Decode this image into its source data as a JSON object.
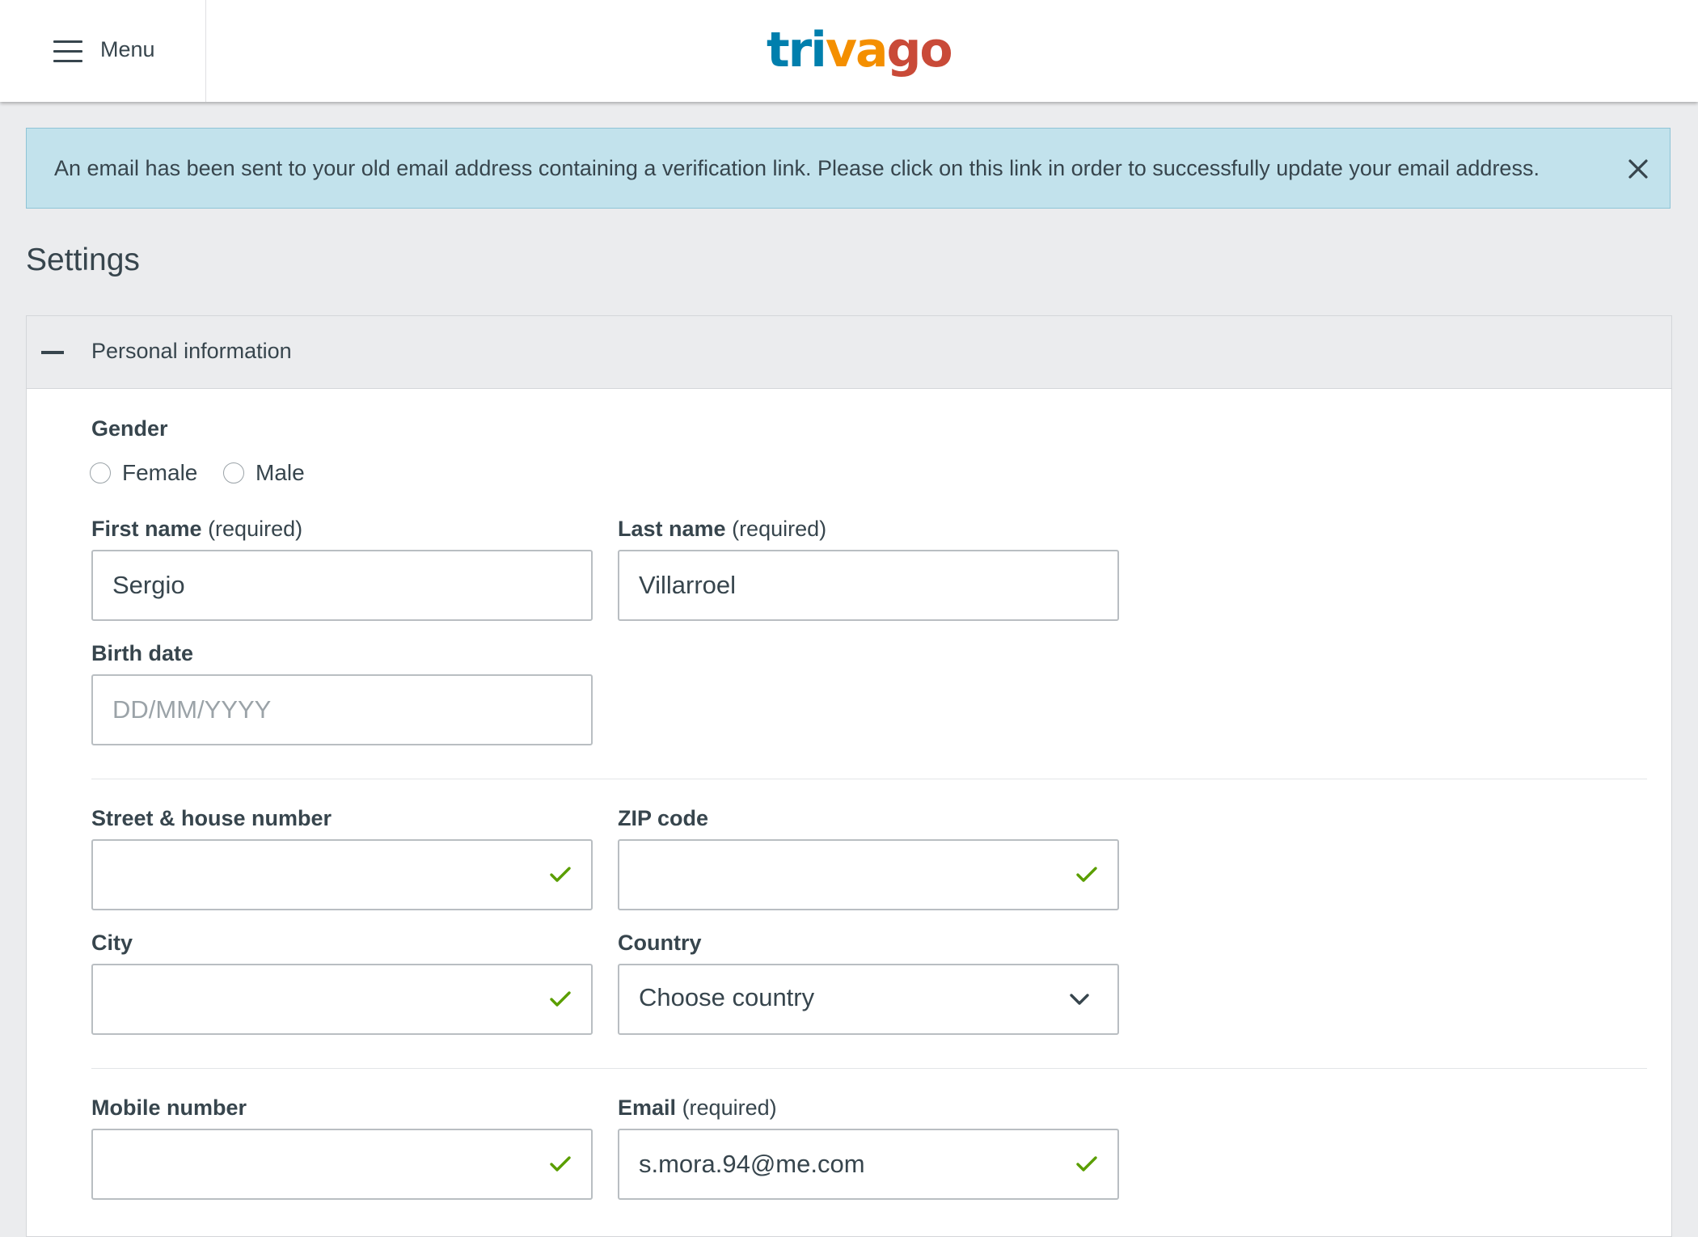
{
  "header": {
    "menu_label": "Menu",
    "logo": {
      "part1": "tri",
      "part2": "va",
      "part3": "go"
    }
  },
  "alert": {
    "message": "An email has been sent to your old email address containing a verification link. Please click on this link in order to successfully update your email address."
  },
  "page_title": "Settings",
  "section": {
    "title": "Personal information",
    "gender": {
      "label": "Gender",
      "options": [
        "Female",
        "Male"
      ]
    },
    "first_name": {
      "label": "First name",
      "suffix": "(required)",
      "value": "Sergio"
    },
    "last_name": {
      "label": "Last name",
      "suffix": "(required)",
      "value": "Villarroel"
    },
    "birth_date": {
      "label": "Birth date",
      "placeholder": "DD/MM/YYYY",
      "value": ""
    },
    "street": {
      "label": "Street & house number",
      "value": ""
    },
    "zip": {
      "label": "ZIP code",
      "value": ""
    },
    "city": {
      "label": "City",
      "value": ""
    },
    "country": {
      "label": "Country",
      "selected": "Choose country"
    },
    "mobile": {
      "label": "Mobile number",
      "value": ""
    },
    "email": {
      "label": "Email",
      "suffix": "(required)",
      "value": "s.mora.94@me.com"
    }
  },
  "icons": {
    "menu": "hamburger-icon",
    "close": "close-icon",
    "collapse": "minus-icon",
    "valid": "checkmark-icon",
    "dropdown": "chevron-down-icon"
  },
  "colors": {
    "brand_blue": "#007fad",
    "brand_orange": "#f48f00",
    "brand_red": "#c94a38",
    "alert_bg": "#c2e2ec",
    "valid_green": "#5a9e00",
    "text": "#37454d"
  }
}
